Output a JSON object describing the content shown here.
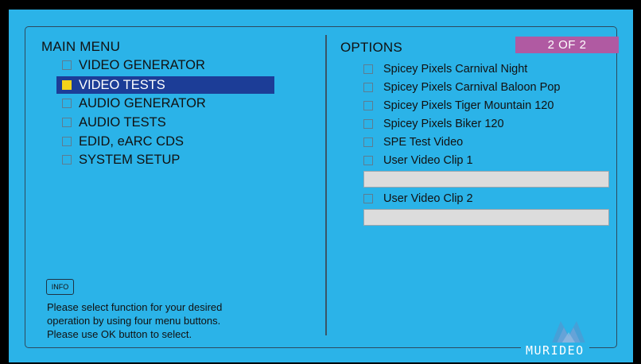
{
  "main_menu": {
    "title": "MAIN MENU",
    "items": [
      {
        "label": "VIDEO GENERATOR",
        "selected": false
      },
      {
        "label": "VIDEO TESTS",
        "selected": true
      },
      {
        "label": "AUDIO GENERATOR",
        "selected": false
      },
      {
        "label": "AUDIO TESTS",
        "selected": false
      },
      {
        "label": "EDID, eARC CDS",
        "selected": false
      },
      {
        "label": "SYSTEM SETUP",
        "selected": false
      }
    ]
  },
  "options": {
    "title": "OPTIONS",
    "page_indicator": "2 OF 2",
    "items": [
      {
        "label": "Spicey Pixels Carnival Night"
      },
      {
        "label": "Spicey Pixels Carnival Baloon Pop"
      },
      {
        "label": "Spicey Pixels Tiger Mountain 120"
      },
      {
        "label": "Spicey Pixels Biker 120"
      },
      {
        "label": "SPE Test Video"
      },
      {
        "label": "User Video Clip 1",
        "field_value": ""
      },
      {
        "label": "User Video Clip 2",
        "field_value": ""
      }
    ]
  },
  "info": {
    "button_label": "INFO",
    "help_lines": [
      "Please select function for your desired",
      "operation by using four menu buttons.",
      "Please use OK button to select."
    ]
  },
  "brand": {
    "name": "MURIDEO",
    "logo_icon": "murideo-logo-icon"
  },
  "colors": {
    "background": "#2bb3e8",
    "selected_row": "#1c3d97",
    "selected_checkbox": "#f3d21a",
    "page_badge": "#b05aa2"
  }
}
